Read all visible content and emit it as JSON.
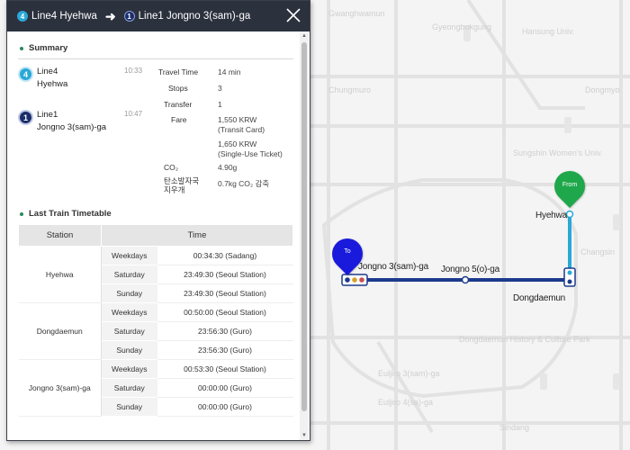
{
  "header": {
    "from_line_num": "4",
    "from_text": "Line4 Hyehwa",
    "to_line_num": "1",
    "to_text": "Line1 Jongno 3(sam)-ga"
  },
  "summary": {
    "title": "Summary",
    "stops": [
      {
        "num": "4",
        "line": "Line4",
        "station": "Hyehwa",
        "time": "10:33",
        "color": "#2aa8d8"
      },
      {
        "num": "1",
        "line": "Line1",
        "station": "Jongno 3(sam)-ga",
        "time": "10:47",
        "color": "#1b2d6b"
      }
    ],
    "info": {
      "travel_time_label": "Travel Time",
      "travel_time": "14 min",
      "stops_label": "Stops",
      "stops": "3",
      "transfer_label": "Transfer",
      "transfer": "1",
      "fare_label": "Fare",
      "fare_card": "1,550 KRW",
      "fare_card_note": "(Transit Card)",
      "fare_ticket": "1,650 KRW",
      "fare_ticket_note": "(Single-Use Ticket)",
      "co2_label": "CO₂",
      "co2": "4.90g",
      "carbon_label_1": "탄소발자국",
      "carbon_label_2": "지우개",
      "carbon": "0.7kg CO₂ 감축"
    }
  },
  "timetable": {
    "title": "Last Train Timetable",
    "col_station": "Station",
    "col_time": "Time",
    "rows": [
      {
        "station": "Hyehwa",
        "entries": [
          {
            "day": "Weekdays",
            "time": "00:34:30 (Sadang)"
          },
          {
            "day": "Saturday",
            "time": "23:49:30 (Seoul Station)"
          },
          {
            "day": "Sunday",
            "time": "23:49:30 (Seoul Station)"
          }
        ]
      },
      {
        "station": "Dongdaemun",
        "entries": [
          {
            "day": "Weekdays",
            "time": "00:50:00 (Seoul Station)"
          },
          {
            "day": "Saturday",
            "time": "23:56:30 (Guro)"
          },
          {
            "day": "Sunday",
            "time": "23:56:30 (Guro)"
          }
        ]
      },
      {
        "station": "Jongno 3(sam)-ga",
        "entries": [
          {
            "day": "Weekdays",
            "time": "00:53:30 (Seoul Station)"
          },
          {
            "day": "Saturday",
            "time": "00:00:00 (Guro)"
          },
          {
            "day": "Sunday",
            "time": "00:00:00 (Guro)"
          }
        ]
      }
    ]
  },
  "map": {
    "pin_from": "From",
    "pin_to": "To",
    "from_color": "#1fa84b",
    "to_color": "#1a1adc",
    "line1_color": "#1b3a8c",
    "line4_color": "#2aa8d8",
    "stations": {
      "hyehwa": "Hyehwa",
      "jongno3": "Jongno 3(sam)-ga",
      "jongno5": "Jongno 5(o)-ga",
      "dongdaemun": "Dongdaemun"
    },
    "faded_labels": [
      "Gwanghwamun",
      "Gyeongbokgung",
      "Sungshin Women's Univ.",
      "Dongdaemun History & Culture Park",
      "Euljiro 3(sam)-ga",
      "Euljiro 4(sa)-ga",
      "Hansung Univ.",
      "Changsin",
      "Dongmyo",
      "Sindang",
      "Chungmuro"
    ]
  }
}
